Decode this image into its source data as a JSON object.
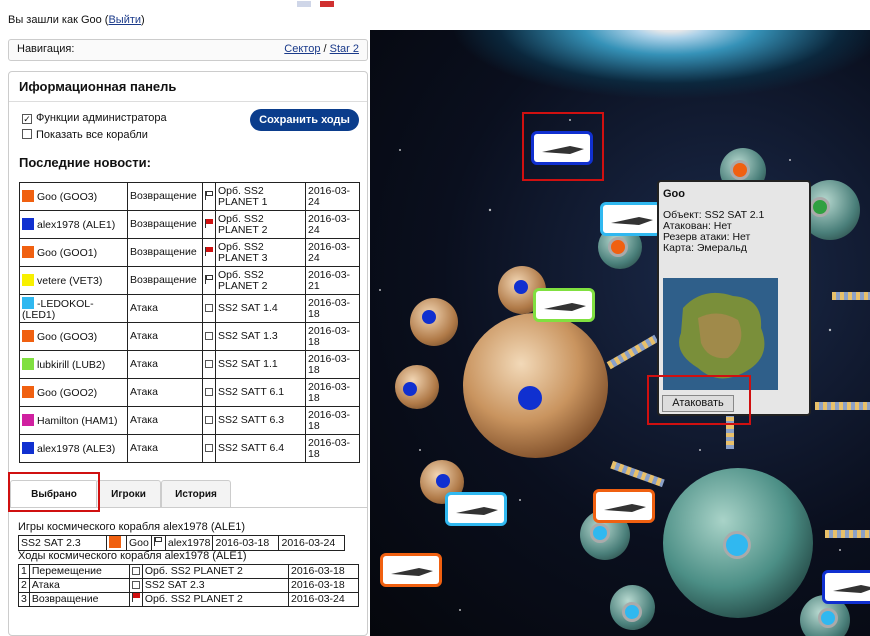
{
  "login": {
    "prefix": "Вы зашли как Goo (",
    "logout": "Выйти",
    "suffix": ")"
  },
  "nav": {
    "label": "Навигация:",
    "sector": "Сектор",
    "sep": "/",
    "star": "Star 2"
  },
  "panel": {
    "title": "Иформационная панель",
    "admin_label": "Функции администратора",
    "admin_checked": true,
    "show_all_label": "Показать все корабли",
    "show_all_checked": false,
    "save_button": "Сохранить ходы",
    "news_title": "Последние новости:"
  },
  "news": [
    {
      "color": "#f06010",
      "name": "Goo (GOO3)",
      "action": "Возвращение",
      "flag": "white",
      "target": "Орб. SS2 PLANET 1",
      "date": "2016-03-24"
    },
    {
      "color": "#1030d0",
      "name": "alex1978 (ALE1)",
      "action": "Возвращение",
      "flag": "red",
      "target": "Орб. SS2 PLANET 2",
      "date": "2016-03-24"
    },
    {
      "color": "#f06010",
      "name": "Goo (GOO1)",
      "action": "Возвращение",
      "flag": "red",
      "target": "Орб. SS2 PLANET 3",
      "date": "2016-03-24"
    },
    {
      "color": "#f8f000",
      "name": "vetere (VET3)",
      "action": "Возвращение",
      "flag": "white",
      "target": "Орб. SS2 PLANET 2",
      "date": "2016-03-21"
    },
    {
      "color": "#30b8f0",
      "name": "-LEDOKOL- (LED1)",
      "action": "Атака",
      "flag": "box",
      "target": "SS2 SAT 1.4",
      "date": "2016-03-18"
    },
    {
      "color": "#f06010",
      "name": "Goo (GOO3)",
      "action": "Атака",
      "flag": "box",
      "target": "SS2 SAT 1.3",
      "date": "2016-03-18"
    },
    {
      "color": "#80e040",
      "name": "lubkirill (LUB2)",
      "action": "Атака",
      "flag": "box",
      "target": "SS2 SAT 1.1",
      "date": "2016-03-18"
    },
    {
      "color": "#f06010",
      "name": "Goo (GOO2)",
      "action": "Атака",
      "flag": "box",
      "target": "SS2 SATT 6.1",
      "date": "2016-03-18"
    },
    {
      "color": "#d020a0",
      "name": "Hamilton (HAM1)",
      "action": "Атака",
      "flag": "box",
      "target": "SS2 SATT 6.3",
      "date": "2016-03-18"
    },
    {
      "color": "#1030d0",
      "name": "alex1978 (ALE3)",
      "action": "Атака",
      "flag": "box",
      "target": "SS2 SATT 6.4",
      "date": "2016-03-18"
    }
  ],
  "tabs": {
    "selected": "Выбрано",
    "players": "Игроки",
    "history": "История"
  },
  "selected": {
    "games_title": "Игры космического корабля alex1978 (ALE1)",
    "game_row": {
      "sat": "SS2 SAT 2.3",
      "color": "#f06010",
      "owner": "Goo",
      "player": "alex1978",
      "date1": "2016-03-18",
      "date2": "2016-03-24"
    },
    "moves_title": "Ходы космического корабля alex1978 (ALE1)",
    "moves": [
      {
        "n": "1",
        "action": "Перемещение",
        "flag": "box",
        "target": "Орб. SS2 PLANET 2",
        "date": "2016-03-18"
      },
      {
        "n": "2",
        "action": "Атака",
        "flag": "box",
        "target": "SS2 SAT 2.3",
        "date": "2016-03-18"
      },
      {
        "n": "3",
        "action": "Возвращение",
        "flag": "red",
        "target": "Орб. SS2 PLANET 2",
        "date": "2016-03-24"
      }
    ]
  },
  "popup": {
    "title": "Goo",
    "object": "Объект: SS2 SAT 2.1",
    "attacked": "Атакован: Нет",
    "reserve": "Резерв атаки: Нет",
    "card": "Карта: Эмеральд",
    "attack_button": "Атаковать"
  }
}
